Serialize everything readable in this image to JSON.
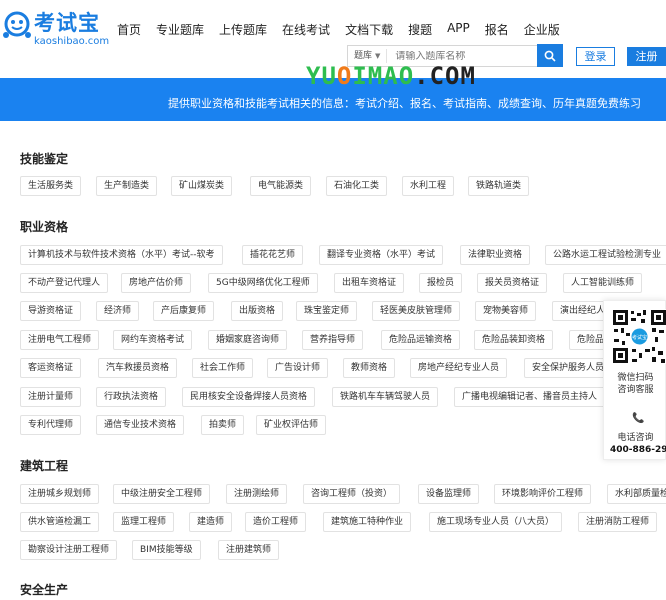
{
  "header": {
    "logo_text": "考试宝",
    "logo_sub": "kaoshibao.com",
    "nav": [
      "首页",
      "专业题库",
      "上传题库",
      "在线考试",
      "文档下载",
      "搜题",
      "APP",
      "报名",
      "企业版"
    ],
    "search_select": "题库",
    "search_placeholder": "请输入题库名称",
    "login_label": "登录",
    "register_label": "注册",
    "brand_color": "#1a7de0"
  },
  "watermark": {
    "p1": "YU",
    "p2": "O",
    "p3": "IMAO",
    "p4": ".COM"
  },
  "banner": {
    "text": "提供职业资格和技能考试相关的信息：考试介绍、报名、考试指南、成绩查询、历年真题免费练习",
    "color": "#1a82f0"
  },
  "sections": [
    {
      "title": "技能鉴定",
      "tags": [
        "生活服务类",
        "生产制造类",
        "矿山煤炭类",
        "电气能源类",
        "石油化工类",
        "水利工程",
        "铁路轨道类"
      ]
    },
    {
      "title": "职业资格",
      "tags": [
        "计算机技术与软件技术资格（水平）考试--软考",
        "插花花艺师",
        "翻译专业资格（水平）考试",
        "法律职业资格",
        "公路水运工程试验检测专业",
        "不动产登记代理人",
        "房地产估价师",
        "5G中级网络优化工程师",
        "出租车资格证",
        "报检员",
        "报关员资格证",
        "人工智能训练师",
        "导游资格证",
        "经济师",
        "产后康复师",
        "出版资格",
        "珠宝鉴定师",
        "轻医美皮肤管理师",
        "宠物美容师",
        "演出经纪人",
        "注册电气工程师",
        "网约车资格考试",
        "婚姻家庭咨询师",
        "营养指导师",
        "危险品运输资格",
        "危险品装卸资格",
        "危险品",
        "客运资格证",
        "汽车救援员资格",
        "社会工作师",
        "广告设计师",
        "教师资格",
        "房地产经纪专业人员",
        "安全保护服务人员",
        "注册计量师",
        "行政执法资格",
        "民用核安全设备焊接人员资格",
        "铁路机车车辆驾驶人员",
        "广播电视编辑记者、播音员主持人",
        "专利代理师",
        "通信专业技术资格",
        "拍卖师",
        "矿业权评估师"
      ]
    },
    {
      "title": "建筑工程",
      "tags": [
        "注册城乡规划师",
        "中级注册安全工程师",
        "注册测绘师",
        "咨询工程师（投资）",
        "设备监理师",
        "环境影响评价工程师",
        "水利部质量检",
        "供水管道检漏工",
        "监理工程师",
        "建造师",
        "造价工程师",
        "建筑施工特种作业",
        "施工现场专业人员（八大员）",
        "注册消防工程师",
        "勘察设计注册工程师",
        "BIM技能等级",
        "注册建筑师"
      ]
    },
    {
      "title": "安全生产",
      "tags": []
    }
  ],
  "side_panel": {
    "qr_label_1": "微信扫码",
    "qr_label_2": "咨询客服",
    "phone_label": "电话咨询",
    "phone_number": "400-886-2980"
  }
}
